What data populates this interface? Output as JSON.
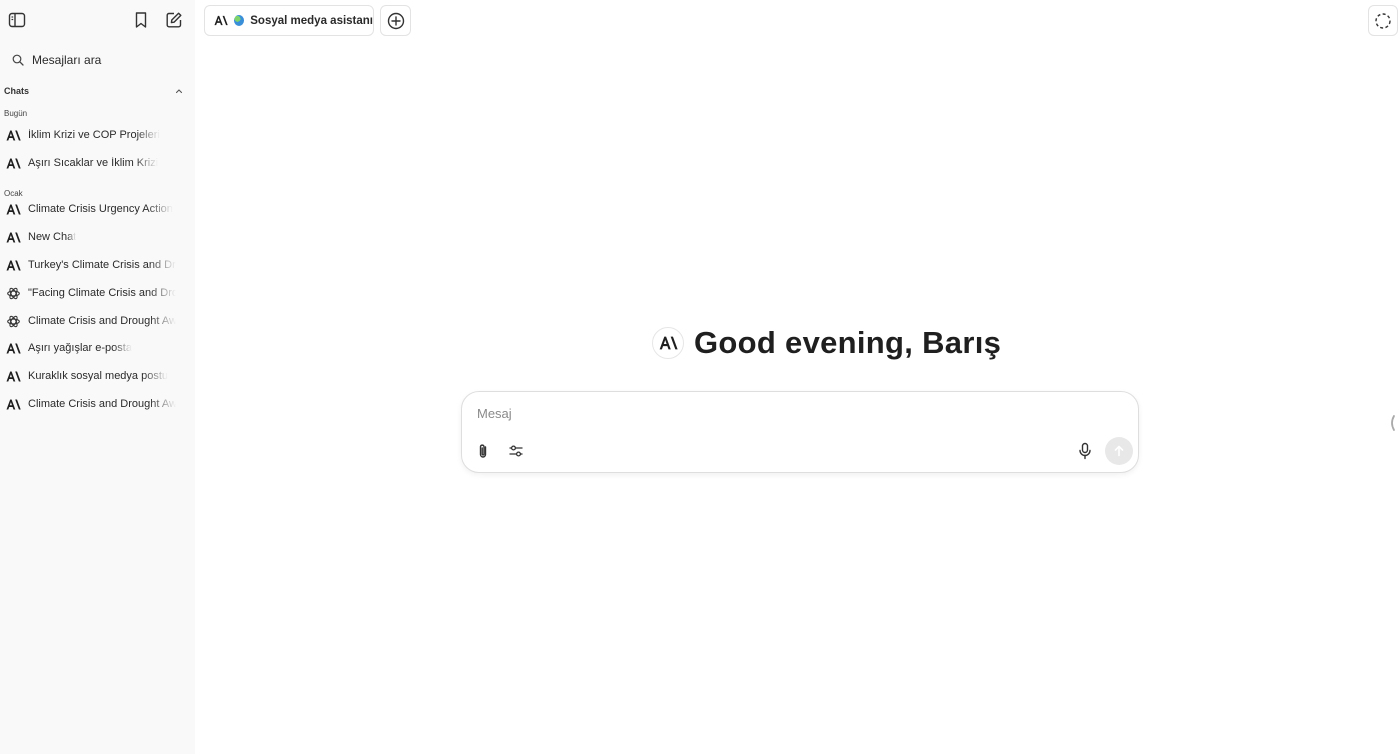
{
  "sidebar": {
    "search_label": "Mesajları ara",
    "section_label": "Chats",
    "groups": [
      {
        "label": "Bugün"
      },
      {
        "label": "Ocak"
      }
    ],
    "items": [
      {
        "label": "İklim Krizi ve COP Projeleri",
        "icon": "anthropic-icon"
      },
      {
        "label": "Aşırı Sıcaklar ve İklim Krizi",
        "icon": "anthropic-icon"
      },
      {
        "label": "Climate Crisis Urgency Action",
        "icon": "anthropic-icon"
      },
      {
        "label": "New Chat",
        "icon": "anthropic-icon"
      },
      {
        "label": "Turkey's Climate Crisis and Drought",
        "icon": "anthropic-icon"
      },
      {
        "label": "\"Facing Climate Crisis and Drought",
        "icon": "openai-icon"
      },
      {
        "label": "Climate Crisis and Drought Awareness",
        "icon": "openai-icon"
      },
      {
        "label": "Aşırı yağışlar e-posta",
        "icon": "anthropic-icon"
      },
      {
        "label": "Kuraklık sosyal medya postu",
        "icon": "anthropic-icon"
      },
      {
        "label": "Climate Crisis and Drought Awareness",
        "icon": "anthropic-icon"
      }
    ]
  },
  "topbar": {
    "gpt_name": "Sosyal medya asistanı"
  },
  "main": {
    "greeting": "Good evening, Barış",
    "composer_placeholder": "Mesaj"
  }
}
